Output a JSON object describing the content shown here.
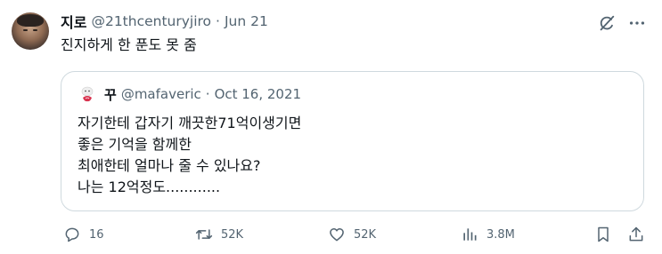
{
  "tweet": {
    "display_name": "지로",
    "handle": "@21thcenturyjiro",
    "separator": "·",
    "date": "Jun 21",
    "text": "진지하게 한 푼도 못 줌"
  },
  "quote": {
    "display_name": "꾸",
    "handle": "@mafaveric",
    "separator": "·",
    "date": "Oct 16, 2021",
    "lines": [
      "자기한테 갑자기 깨끗한71억이생기면",
      "좋은 기억을 함께한",
      "최애한테 얼마나 줄 수 있나요?",
      "나는 12억정도............"
    ]
  },
  "actions": {
    "replies": "16",
    "reposts": "52K",
    "likes": "52K",
    "views": "3.8M"
  },
  "icons": {
    "grok": "grok-slash-icon",
    "more": "more-dots-icon",
    "reply": "reply-bubble-icon",
    "repost": "repost-arrows-icon",
    "like": "heart-icon",
    "views": "views-bars-icon",
    "bookmark": "bookmark-icon",
    "share": "share-icon"
  },
  "colors": {
    "text": "#0f1419",
    "secondary": "#536471",
    "border": "#cfd9de"
  }
}
